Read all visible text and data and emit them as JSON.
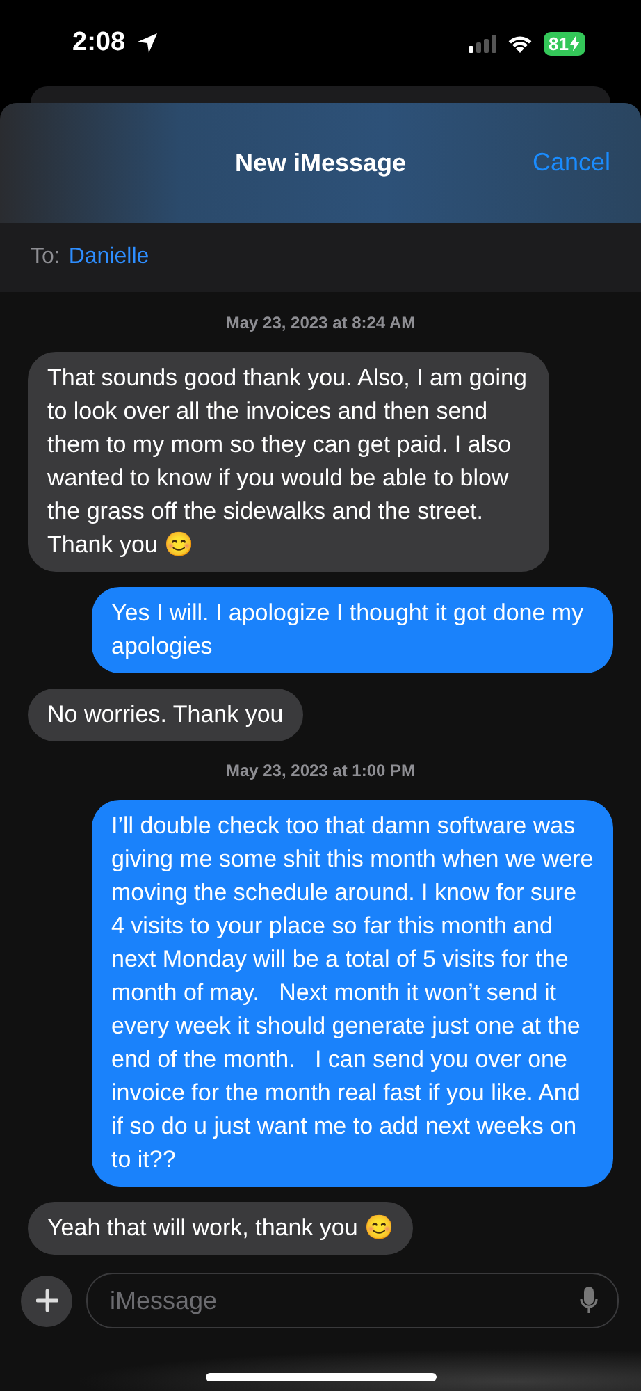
{
  "status_bar": {
    "time": "2:08",
    "battery": "81"
  },
  "header": {
    "title": "New iMessage",
    "cancel": "Cancel"
  },
  "recipient": {
    "label": "To:",
    "name": "Danielle"
  },
  "messages": [
    {
      "kind": "timestamp",
      "text": "May 23, 2023 at 8:24 AM"
    },
    {
      "kind": "received",
      "text": "That sounds good thank you. Also, I am going to look over all the invoices and then send them to my mom so they can get paid. I also wanted to know if you would be able to blow the grass off the sidewalks and the street. Thank you 😊"
    },
    {
      "kind": "sent",
      "text": "Yes I will. I apologize I thought it got done my apologies"
    },
    {
      "kind": "received",
      "text": "No worries. Thank you"
    },
    {
      "kind": "timestamp",
      "text": "May 23, 2023 at 1:00 PM"
    },
    {
      "kind": "sent",
      "text": "I’ll double check too that damn software was giving me some shit this month when we were moving the schedule around. I know for sure 4 visits to your place so far this month and next Monday will be a total of 5 visits for the month of may.   Next month it won’t send it every week it should generate just one at the end of the month.   I can send you over one invoice for the month real fast if you like. And if so do u just want me to add next weeks on to it??"
    },
    {
      "kind": "received",
      "text": "Yeah that will work, thank you 😊"
    }
  ],
  "composer": {
    "placeholder": "iMessage"
  }
}
